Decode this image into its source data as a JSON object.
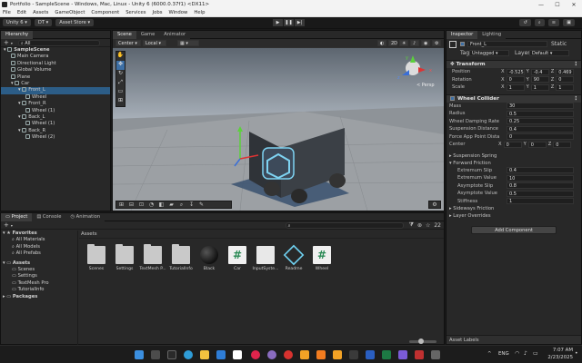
{
  "window": {
    "title": "Portfolio - SampleScene - Windows, Mac, Linux - Unity 6 (6000.0.37f1) <DX11>",
    "controls": [
      "—",
      "☐",
      "✕"
    ]
  },
  "menu": [
    "File",
    "Edit",
    "Assets",
    "GameObject",
    "Component",
    "Services",
    "Jobs",
    "Window",
    "Help"
  ],
  "toolbar": {
    "account": "Unity 6",
    "dt": "DT",
    "asset_store": "Asset Store",
    "layout_label": "Layout"
  },
  "hierarchy": {
    "tab": "Hierarchy",
    "search_placeholder": "All",
    "items": [
      {
        "label": "SampleScene",
        "depth": 0,
        "sel": false
      },
      {
        "label": "Main Camera",
        "depth": 1,
        "sel": false
      },
      {
        "label": "Directional Light",
        "depth": 1,
        "sel": false
      },
      {
        "label": "Global Volume",
        "depth": 1,
        "sel": false
      },
      {
        "label": "Plane",
        "depth": 1,
        "sel": false
      },
      {
        "label": "Car",
        "depth": 1,
        "sel": false
      },
      {
        "label": "Front_L",
        "depth": 2,
        "sel": true
      },
      {
        "label": "Wheel",
        "depth": 3,
        "sel": false
      },
      {
        "label": "Front_R",
        "depth": 2,
        "sel": false
      },
      {
        "label": "Wheel (1)",
        "depth": 3,
        "sel": false
      },
      {
        "label": "Back_L",
        "depth": 2,
        "sel": false
      },
      {
        "label": "Wheel (1)",
        "depth": 3,
        "sel": false
      },
      {
        "label": "Back_R",
        "depth": 2,
        "sel": false
      },
      {
        "label": "Wheel (2)",
        "depth": 3,
        "sel": false
      }
    ]
  },
  "scene": {
    "tabs": [
      "Scene",
      "Game",
      "Animator"
    ],
    "pivot": "Center",
    "space": "Local",
    "persp_label": "< Persp",
    "view_2d": "2D",
    "gizmo_axes": {
      "y": "y",
      "x": "x",
      "z": "z"
    }
  },
  "inspector": {
    "tabs": [
      "Inspector",
      "Lighting"
    ],
    "object_name": "Front_L",
    "static_label": "Static",
    "tag_label": "Tag",
    "tag_value": "Untagged",
    "layer_label": "Layer",
    "layer_value": "Default",
    "transform": {
      "title": "Transform",
      "rows": [
        {
          "label": "Position",
          "x": "-0.525",
          "y": "-0.4",
          "z": "0.469"
        },
        {
          "label": "Rotation",
          "x": "0",
          "y": "90",
          "z": "0"
        },
        {
          "label": "Scale",
          "x": "1",
          "y": "1",
          "z": "1"
        }
      ]
    },
    "wheel_collider": {
      "title": "Wheel Collider",
      "fields": [
        {
          "label": "Mass",
          "value": "30"
        },
        {
          "label": "Radius",
          "value": "0.5"
        },
        {
          "label": "Wheel Damping Rate",
          "value": "0.25"
        },
        {
          "label": "Suspension Distance",
          "value": "0.4"
        },
        {
          "label": "Force App Point Dista",
          "value": "0"
        }
      ],
      "center": {
        "label": "Center",
        "x": "0",
        "y": "0",
        "z": "0"
      },
      "suspension_spring": "Suspension Spring",
      "forward_friction": "Forward Friction",
      "friction_fields": [
        {
          "label": "Extremum Slip",
          "value": "0.4"
        },
        {
          "label": "Extremum Value",
          "value": "10"
        },
        {
          "label": "Asymptote Slip",
          "value": "0.8"
        },
        {
          "label": "Asymptote Value",
          "value": "0.5"
        },
        {
          "label": "Stiffness",
          "value": "1"
        }
      ],
      "sideways_friction": "Sideways Friction",
      "layer_overrides": "Layer Overrides"
    },
    "add_component": "Add Component",
    "asset_labels": "Asset Labels"
  },
  "project": {
    "tabs": [
      "Project",
      "Console",
      "Animation"
    ],
    "favorites_title": "Favorites",
    "favorites": [
      "All Materials",
      "All Models",
      "All Prefabs"
    ],
    "assets_title": "Assets",
    "asset_tree": [
      "Scenes",
      "Settings",
      "TextMesh Pro",
      "TutorialInfo"
    ],
    "packages_title": "Packages",
    "breadcrumb": "Assets",
    "count": "22",
    "items": [
      {
        "label": "Scenes",
        "kind": "folder"
      },
      {
        "label": "Settings",
        "kind": "folder"
      },
      {
        "label": "TextMesh P...",
        "kind": "folder"
      },
      {
        "label": "TutorialInfo",
        "kind": "folder"
      },
      {
        "label": "Black",
        "kind": "material"
      },
      {
        "label": "Car",
        "kind": "script"
      },
      {
        "label": "InputSyste...",
        "kind": "input"
      },
      {
        "label": "Readme",
        "kind": "readme"
      },
      {
        "label": "Wheel",
        "kind": "script"
      }
    ]
  },
  "taskbar": {
    "lang": "ENG",
    "time": "7:07 AM",
    "date": "2/23/2025"
  }
}
